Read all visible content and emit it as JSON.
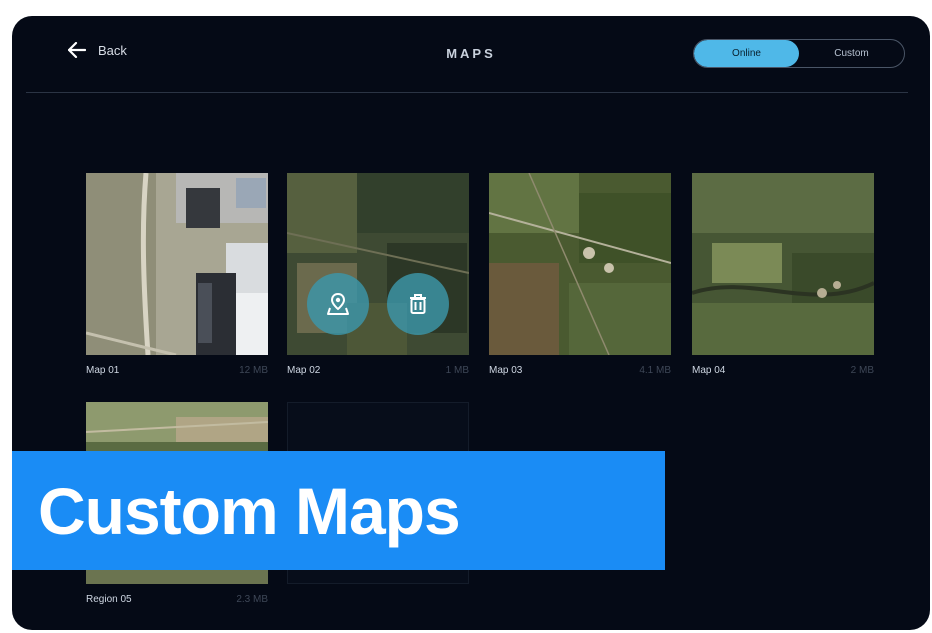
{
  "header": {
    "back_label": "Back",
    "title": "MAPS",
    "toggle": {
      "active": "Online",
      "inactive": "Custom"
    }
  },
  "maps": [
    {
      "name": "Map 01",
      "meta": "12 MB"
    },
    {
      "name": "Map 02",
      "meta": "1 MB"
    },
    {
      "name": "Map 03",
      "meta": "4.1 MB"
    },
    {
      "name": "Map 04",
      "meta": "2 MB"
    },
    {
      "name": "Region 05",
      "meta": "2.3 MB"
    }
  ],
  "banner": {
    "text": "Custom Maps"
  },
  "icons": {
    "back": "arrow-left-icon",
    "map_action": "map-pin-icon",
    "delete_action": "trash-icon"
  },
  "colors": {
    "background": "#050a16",
    "accent": "#4fb8e8",
    "banner": "#1a8cf5",
    "action_button": "#3c96aa"
  }
}
